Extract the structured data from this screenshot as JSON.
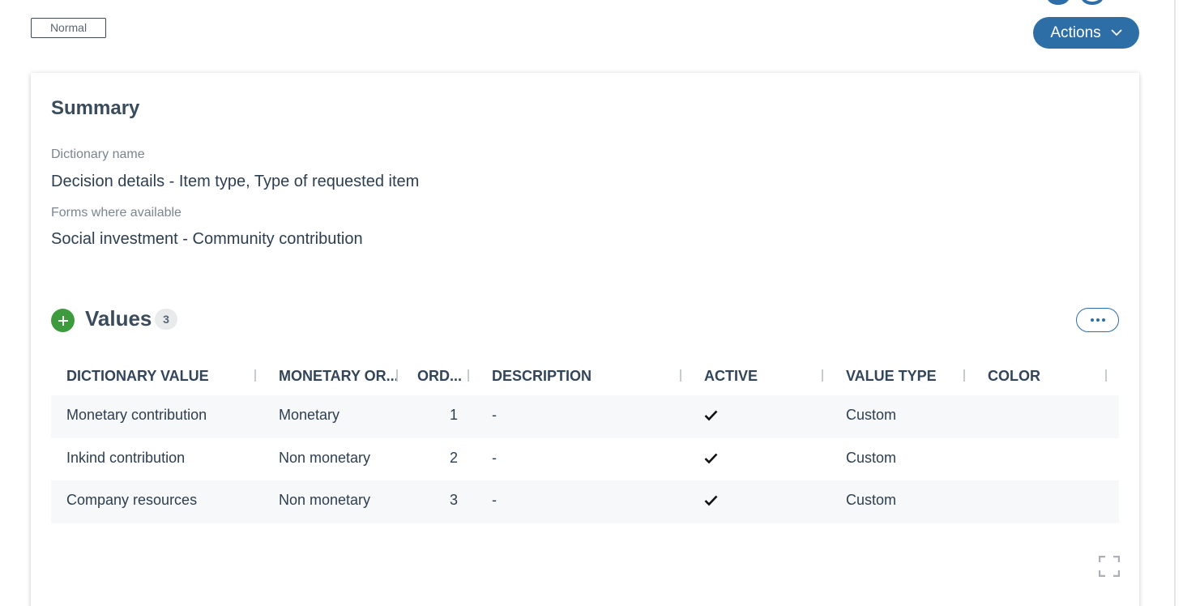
{
  "header": {
    "status_label": "Normal",
    "actions_label": "Actions"
  },
  "summary": {
    "title": "Summary",
    "fields": [
      {
        "label": "Dictionary name",
        "value": "Decision details - Item type, Type of requested item"
      },
      {
        "label": "Forms where available",
        "value": "Social investment - Community contribution"
      }
    ]
  },
  "values_section": {
    "title": "Values",
    "count": "3",
    "columns": [
      "DICTIONARY VALUE",
      "MONETARY OR...",
      "ORD...",
      "DESCRIPTION",
      "ACTIVE",
      "VALUE TYPE",
      "COLOR"
    ],
    "rows": [
      {
        "dictionary_value": "Monetary contribution",
        "monetary": "Monetary",
        "order": "1",
        "description": "-",
        "active": true,
        "value_type": "Custom",
        "color": ""
      },
      {
        "dictionary_value": "Inkind contribution",
        "monetary": "Non monetary",
        "order": "2",
        "description": "-",
        "active": true,
        "value_type": "Custom",
        "color": ""
      },
      {
        "dictionary_value": "Company resources",
        "monetary": "Non monetary",
        "order": "3",
        "description": "-",
        "active": true,
        "value_type": "Custom",
        "color": ""
      }
    ]
  },
  "icons": {
    "add": "plus-icon",
    "more": "ellipsis-icon",
    "active": "check-icon",
    "expand": "fullscreen-icon",
    "actions_chevron": "chevron-down-icon"
  },
  "colors": {
    "primary": "#2e6ea6",
    "add_green": "#3d9a3d",
    "text": "#2d3e50",
    "muted": "#7b858f"
  }
}
